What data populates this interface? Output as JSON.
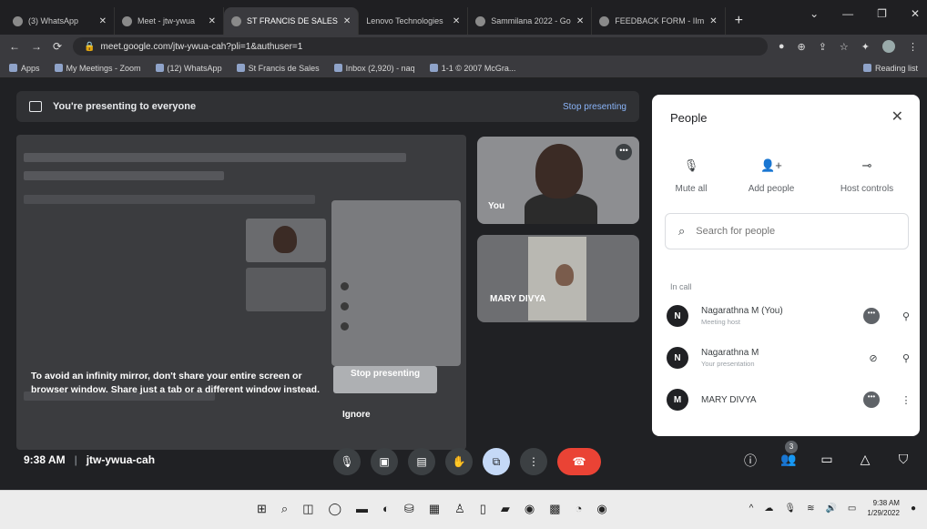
{
  "browser": {
    "tabs": [
      {
        "label": "(3) WhatsApp",
        "active": false
      },
      {
        "label": "Meet - jtw-ywua",
        "active": false
      },
      {
        "label": "ST FRANCIS DE SALES",
        "active": true
      },
      {
        "label": "Lenovo Technologies",
        "active": false
      },
      {
        "label": "Sammilana 2022 - Go",
        "active": false
      },
      {
        "label": "FEEDBACK FORM - IIm",
        "active": false
      }
    ],
    "url": "meet.google.com/jtw-ywua-cah?pli=1&authuser=1",
    "bookmarks": [
      "Apps",
      "My Meetings - Zoom",
      "(12) WhatsApp",
      "St Francis de Sales",
      "Inbox (2,920) - naq",
      "1-1 © 2007 McGra..."
    ],
    "reading_list": "Reading list"
  },
  "meet": {
    "banner_text": "You're presenting to everyone",
    "banner_stop": "Stop presenting",
    "infinity_warning": "To avoid an infinity mirror, don't share your entire screen or browser window. Share just a tab or a different window instead.",
    "stop_presenting_btn": "Stop presenting",
    "ignore_label": "Ignore",
    "tile_you": "You",
    "tile_mary": "MARY DIVYA",
    "time": "9:38 AM",
    "separator": "|",
    "meeting_code": "jtw-ywua-cah",
    "people_badge": "3"
  },
  "people_panel": {
    "title": "People",
    "mute_all": "Mute all",
    "add_people": "Add people",
    "host_controls": "Host controls",
    "search_placeholder": "Search for people",
    "in_call": "In call",
    "participants": [
      {
        "initial": "N",
        "name": "Nagarathna M (You)",
        "sub": "Meeting host"
      },
      {
        "initial": "N",
        "name": "Nagarathna M",
        "sub": "Your presentation"
      },
      {
        "initial": "M",
        "name": "MARY DIVYA",
        "sub": ""
      }
    ]
  },
  "taskbar": {
    "time": "9:38 AM",
    "date": "1/29/2022"
  }
}
